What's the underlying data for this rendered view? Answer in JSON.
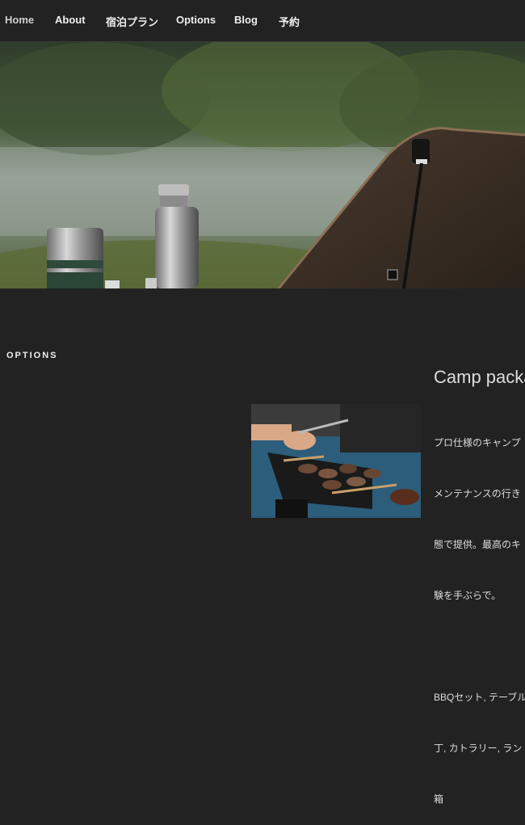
{
  "nav": {
    "items": [
      {
        "label": "Home",
        "active": true
      },
      {
        "label": "About",
        "active": false
      },
      {
        "label": "宿泊プラン",
        "active": false
      },
      {
        "label": "Options",
        "active": false
      },
      {
        "label": "Blog",
        "active": false
      },
      {
        "label": "予約",
        "active": false
      }
    ]
  },
  "options_section": {
    "heading": "OPTIONS",
    "package_title": "Camp packa",
    "paragraph_1_line_1": "プロ仕様のキャンプ",
    "paragraph_1_line_2": "メンテナンスの行き",
    "paragraph_1_line_3": "態で提供。最高のキ",
    "paragraph_1_line_4": "験を手ぶらで。",
    "paragraph_2_line_1": "BBQセット, テーブル",
    "paragraph_2_line_2": "丁, カトラリー, ラン",
    "paragraph_2_line_3": "箱"
  },
  "colors": {
    "background": "#222222",
    "text": "#eeeeee"
  }
}
